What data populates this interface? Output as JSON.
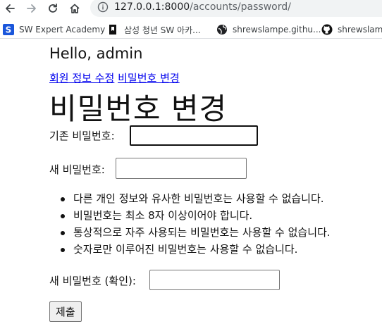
{
  "browser": {
    "url_host": "127.0.0.1:8000",
    "url_path": "/accounts/password/",
    "bookmarks": [
      {
        "label": "SW Expert Academy",
        "icon": "sw-expert-academy-logo-icon"
      },
      {
        "label": "삼성 청년 SW 아카...",
        "icon": "bookmark-flag-icon"
      },
      {
        "label": "shrewslampe.githu...",
        "icon": "globe-icon"
      },
      {
        "label": "shrewslamp",
        "icon": "github-icon"
      }
    ]
  },
  "page": {
    "greeting": "Hello, admin",
    "nav_links": [
      "회원 정보 수정",
      "비밀번호 변경"
    ],
    "title": "비밀번호 변경",
    "form": {
      "old_password_label": "기존 비밀번호:",
      "old_password_value": "",
      "new_password_label": "새 비밀번호:",
      "new_password_value": "",
      "password_rules": [
        "다른 개인 정보와 유사한 비밀번호는 사용할 수 없습니다.",
        "비밀번호는 최소 8자 이상이어야 합니다.",
        "통상적으로 자주 사용되는 비밀번호는 사용할 수 없습니다.",
        "숫자로만 이루어진 비밀번호는 사용할 수 없습니다."
      ],
      "confirm_password_label": "새 비밀번호 (확인):",
      "confirm_password_value": "",
      "submit_label": "제출"
    }
  },
  "colors": {
    "link": "#0000ee",
    "omnibox_bg": "#f1f3f4",
    "sw_logo": "#1a56db"
  }
}
